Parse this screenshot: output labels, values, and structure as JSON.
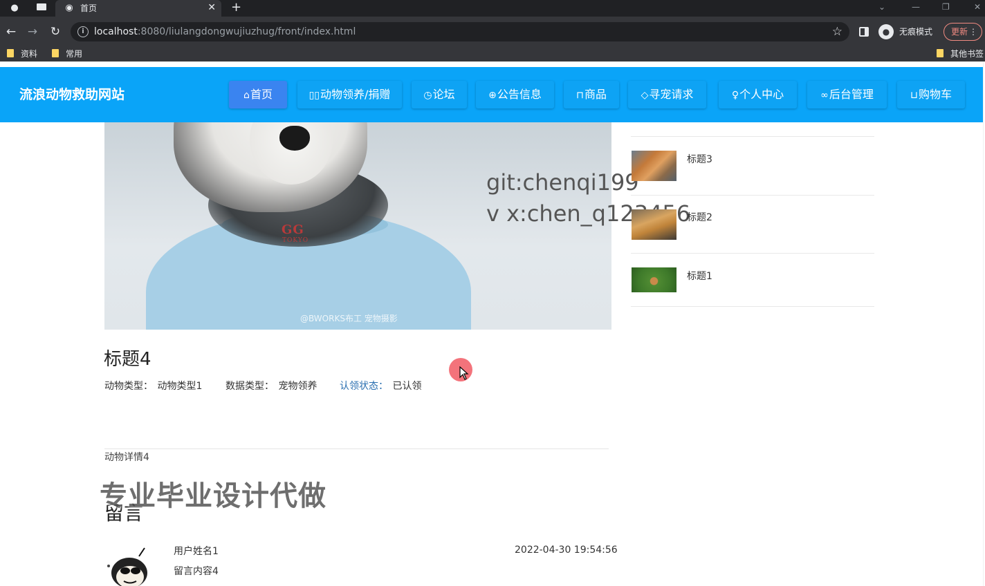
{
  "browser": {
    "tab_title": "首页",
    "url_host": "localhost",
    "url_rest": ":8080/liulangdongwujiuzhug/front/index.html",
    "incognito_label": "无痕模式",
    "update_label": "更新",
    "bookmarks": [
      "资料",
      "常用"
    ],
    "other_bookmarks": "其他书签"
  },
  "site": {
    "title": "流浪动物救助网站",
    "nav": [
      {
        "label": "首页",
        "icon": "home-icon",
        "active": true
      },
      {
        "label": "动物领养/捐赠",
        "icon": "columns-icon"
      },
      {
        "label": "论坛",
        "icon": "clock-icon"
      },
      {
        "label": "公告信息",
        "icon": "globe-icon"
      },
      {
        "label": "商品",
        "icon": "book-icon"
      },
      {
        "label": "寻宠请求",
        "icon": "tag-icon"
      },
      {
        "label": "个人中心",
        "icon": "user-icon"
      },
      {
        "label": "后台管理",
        "icon": "link-icon"
      },
      {
        "label": "购物车",
        "icon": "cart-icon"
      }
    ]
  },
  "hero": {
    "shirt_logo": "GG",
    "shirt_sub": "TOKYO",
    "photo_credit": "@BWORKS布工 宠物摄影"
  },
  "watermark": {
    "line1": "git:chenqi199",
    "line2": "v x:chen_q123456",
    "banner": "专业毕业设计代做"
  },
  "sidebar": {
    "items": [
      {
        "title": "标题3"
      },
      {
        "title": "标题2"
      },
      {
        "title": "标题1"
      }
    ]
  },
  "detail": {
    "title": "标题4",
    "animal_type_label": "动物类型：",
    "animal_type_value": "动物类型1",
    "data_type_label": "数据类型：",
    "data_type_value": "宠物领养",
    "adopt_status_label": "认领状态：",
    "adopt_status_value": "已认领",
    "description": "动物详情4"
  },
  "comments": {
    "section_title": "留言",
    "items": [
      {
        "user": "用户姓名1",
        "time": "2022-04-30 19:54:56",
        "content": "留言内容4"
      }
    ]
  }
}
